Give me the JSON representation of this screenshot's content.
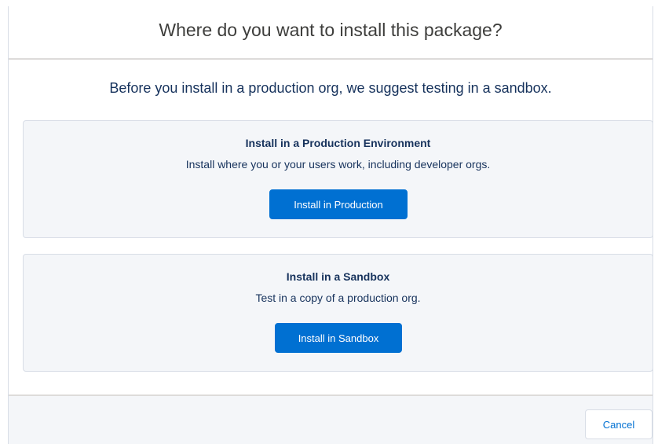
{
  "header": {
    "title": "Where do you want to install this package?"
  },
  "body": {
    "intro": "Before you install in a production org, we suggest testing in a sandbox.",
    "production": {
      "title": "Install in a Production Environment",
      "description": "Install where you or your users work, including developer orgs.",
      "button_label": "Install in Production"
    },
    "sandbox": {
      "title": "Install in a Sandbox",
      "description": "Test in a copy of a production org.",
      "button_label": "Install in Sandbox"
    }
  },
  "footer": {
    "cancel_label": "Cancel"
  },
  "colors": {
    "brand": "#0070d2",
    "text": "#16325c",
    "panel_bg": "#f4f6f9",
    "border": "#d8dde6"
  }
}
